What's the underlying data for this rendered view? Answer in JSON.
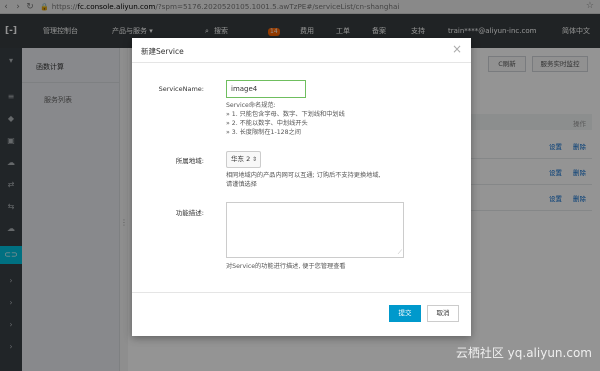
{
  "browser": {
    "url_scheme": "https://",
    "url_domain": "fc.console.aliyun.com",
    "url_rest": "/?spm=5176.2020520105.1001.5.awTzPE#/serviceList/cn-shanghai"
  },
  "topnav": {
    "console": "管理控制台",
    "products": "产品与服务 ▾",
    "search": "搜索",
    "badge": "14",
    "fees": "费用",
    "tickets": "工单",
    "beian": "备案",
    "support": "支持",
    "user": "train****@aliyun-inc.com",
    "language": "简体中文"
  },
  "sidebar": {
    "title": "函数计算",
    "service_list": "服务列表"
  },
  "main": {
    "refresh": "C刷新",
    "monitor": "服务实时监控",
    "op_header": "操作",
    "rows": [
      {
        "settings": "设置",
        "delete": "删除"
      },
      {
        "settings": "设置",
        "delete": "删除"
      },
      {
        "settings": "设置",
        "delete": "删除"
      }
    ]
  },
  "modal": {
    "title": "新建Service",
    "service_name_label": "ServiceName:",
    "service_name_value": "image4",
    "name_rules": [
      "Service命名规范:",
      "» 1. 只能包含字母、数字、下划线和中划线",
      "» 2. 不能以数字、中划线开头",
      "» 3. 长度限制在1-128之间"
    ],
    "region_label": "所属地域:",
    "region_value": "华东 2",
    "region_hints": [
      "相同地域内的产品内网可以互通; 订购后不支持更换地域,",
      "请谨慎选择"
    ],
    "desc_label": "功能描述:",
    "desc_hint": "对Service的功能进行描述, 便于您管理查看",
    "submit": "提交",
    "cancel": "取消"
  },
  "watermark": "云栖社区 yq.aliyun.com",
  "colors": {
    "topnav": "#373d41",
    "accent": "#00c1de",
    "primary_button": "#0099cc",
    "input_focus": "#6fbe5f"
  }
}
